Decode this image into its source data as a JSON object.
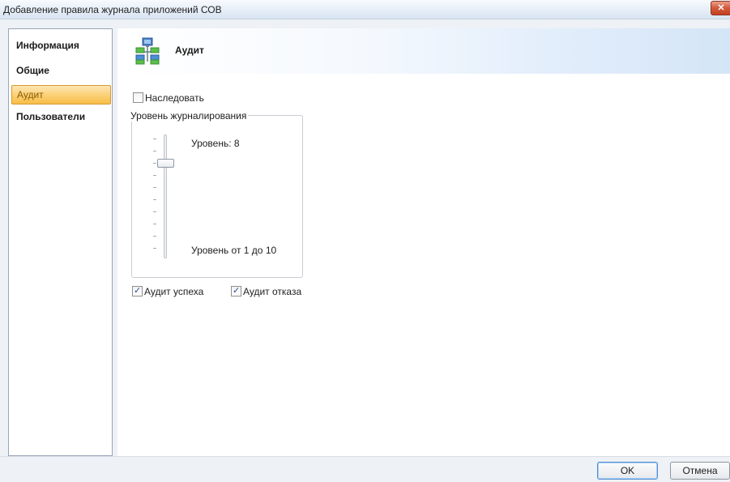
{
  "window": {
    "title": "Добавление правила журнала приложений СОВ",
    "close_glyph": "✕"
  },
  "nav": {
    "items": [
      {
        "label": "Информация",
        "selected": false
      },
      {
        "label": "Общие",
        "selected": false
      },
      {
        "label": "Аудит",
        "selected": true
      },
      {
        "label": "Пользователи",
        "selected": false
      }
    ]
  },
  "header": {
    "title": "Аудит",
    "icon": "network-audit-icon"
  },
  "inherit": {
    "label": "Наследовать",
    "checked": false
  },
  "logging": {
    "group_label": "Уровень журналирования",
    "level_text": "Уровень: 8",
    "range_text": "Уровень от 1 до 10",
    "level_value": 8,
    "min": 1,
    "max": 10
  },
  "audit": {
    "success_label": "Аудит успеха",
    "success_checked": true,
    "failure_label": "Аудит отказа",
    "failure_checked": true
  },
  "buttons": {
    "ok": "OK",
    "cancel": "Отмена"
  },
  "colors": {
    "selected_nav": "#f7bd48",
    "header_band": "#d4e5f7",
    "close_button": "#c2401f"
  }
}
